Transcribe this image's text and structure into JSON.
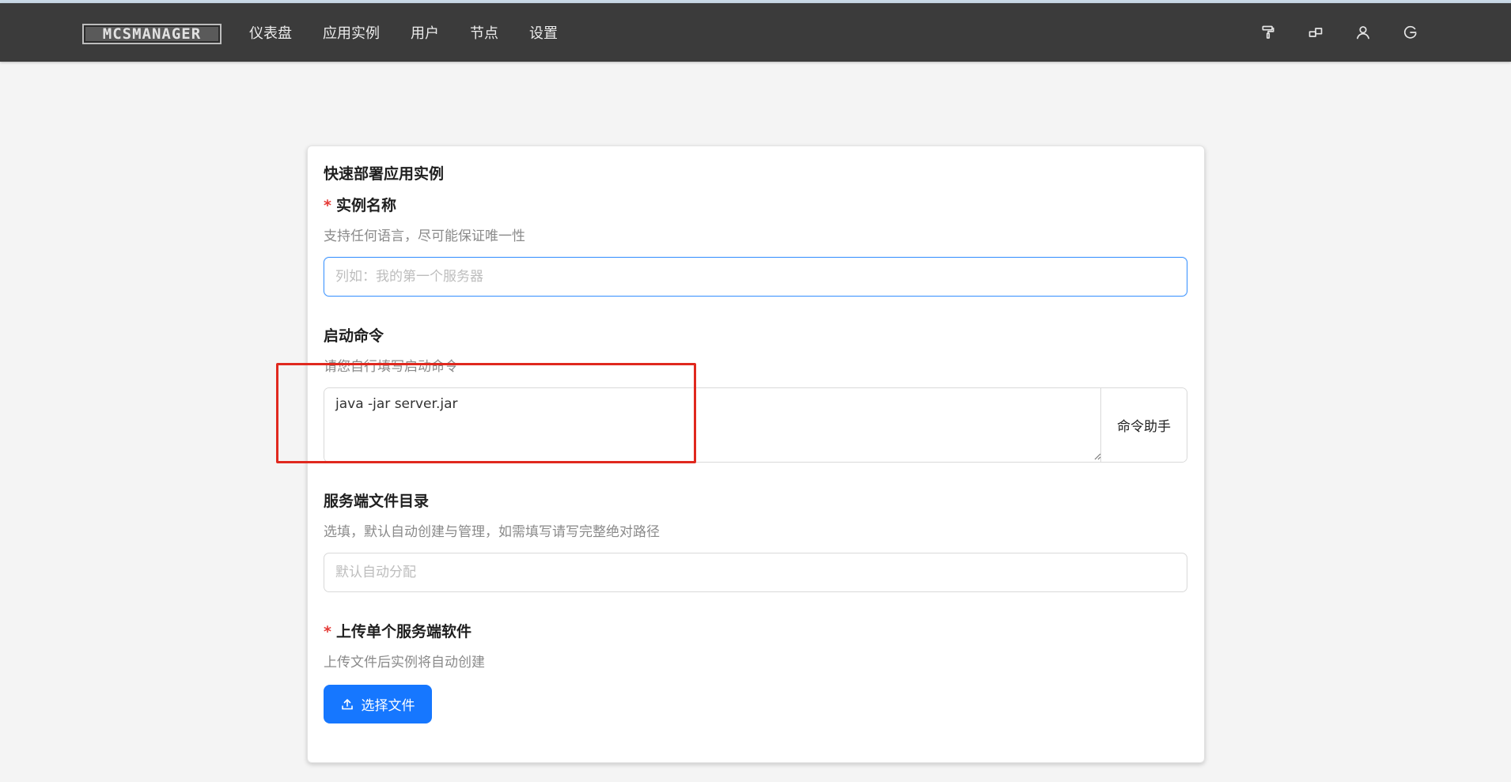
{
  "header": {
    "logo_text": "MCSMANAGER",
    "nav": [
      {
        "label": "仪表盘"
      },
      {
        "label": "应用实例"
      },
      {
        "label": "用户"
      },
      {
        "label": "节点"
      },
      {
        "label": "设置"
      }
    ],
    "tools": [
      {
        "icon": "paint-roller-icon"
      },
      {
        "icon": "layout-icon"
      },
      {
        "icon": "user-icon"
      },
      {
        "icon": "logout-icon"
      }
    ]
  },
  "card": {
    "title": "快速部署应用实例",
    "instance_name": {
      "required_mark": "*",
      "label": "实例名称",
      "description": "支持任何语言，尽可能保证唯一性",
      "placeholder": "列如：我的第一个服务器",
      "value": ""
    },
    "start_command": {
      "label": "启动命令",
      "description": "请您自行填写启动命令",
      "value": "java -jar server.jar",
      "helper_button": "命令助手"
    },
    "server_directory": {
      "label": "服务端文件目录",
      "description": "选填，默认自动创建与管理，如需填写请写完整绝对路径",
      "placeholder": "默认自动分配",
      "value": ""
    },
    "upload": {
      "required_mark": "*",
      "label": "上传单个服务端软件",
      "description": "上传文件后实例将自动创建",
      "button_label": "选择文件"
    }
  },
  "colors": {
    "header_bg": "#3b3b3b",
    "accent": "#1677ff",
    "required": "#e53935",
    "highlight": "#e0281e"
  }
}
